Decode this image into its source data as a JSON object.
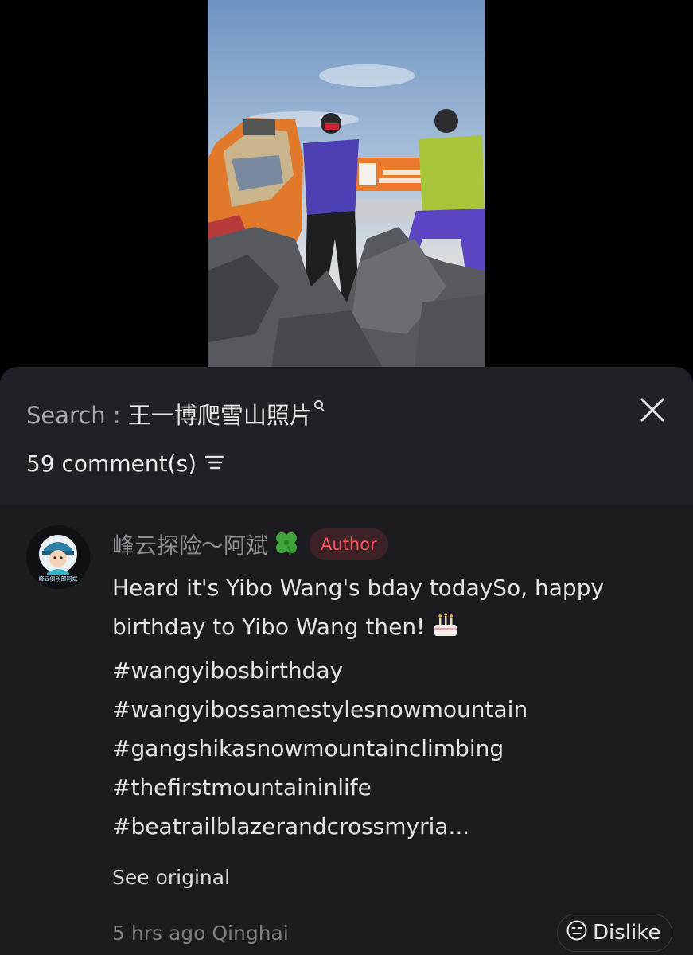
{
  "search": {
    "label": "Search : ",
    "query": "王一博爬雪山照片"
  },
  "comments_header": {
    "count_label": "59 comment(s)"
  },
  "comment": {
    "author": "峰云探险～阿斌",
    "author_badge": "Author",
    "avatar_caption": "峰云俱乐部阿斌",
    "lines": [
      "Heard it's Yibo Wang's bday todaySo, happy",
      "birthday to Yibo Wang then!",
      "#wangyibosbirthday",
      "#wangyibossamestylesnowmountain",
      "#gangshikasnowmountainclimbing",
      "#thefirstmountaininlife",
      "#beatrailblazerandcrossmyria..."
    ],
    "see_original": "See original",
    "meta": "5 hrs ago Qinghai",
    "dislike_label": "Dislike"
  },
  "icons": {
    "close": "close-icon",
    "search": "search-icon",
    "sort": "sort-icon",
    "clover": "four-leaf-clover-icon",
    "cake": "birthday-cake-icon",
    "dislike": "neutral-face-icon"
  },
  "colors": {
    "sheet_bg": "#1b1b20",
    "header_bg": "#202026",
    "badge_text": "#ff5360",
    "badge_bg": "#3c2126"
  }
}
